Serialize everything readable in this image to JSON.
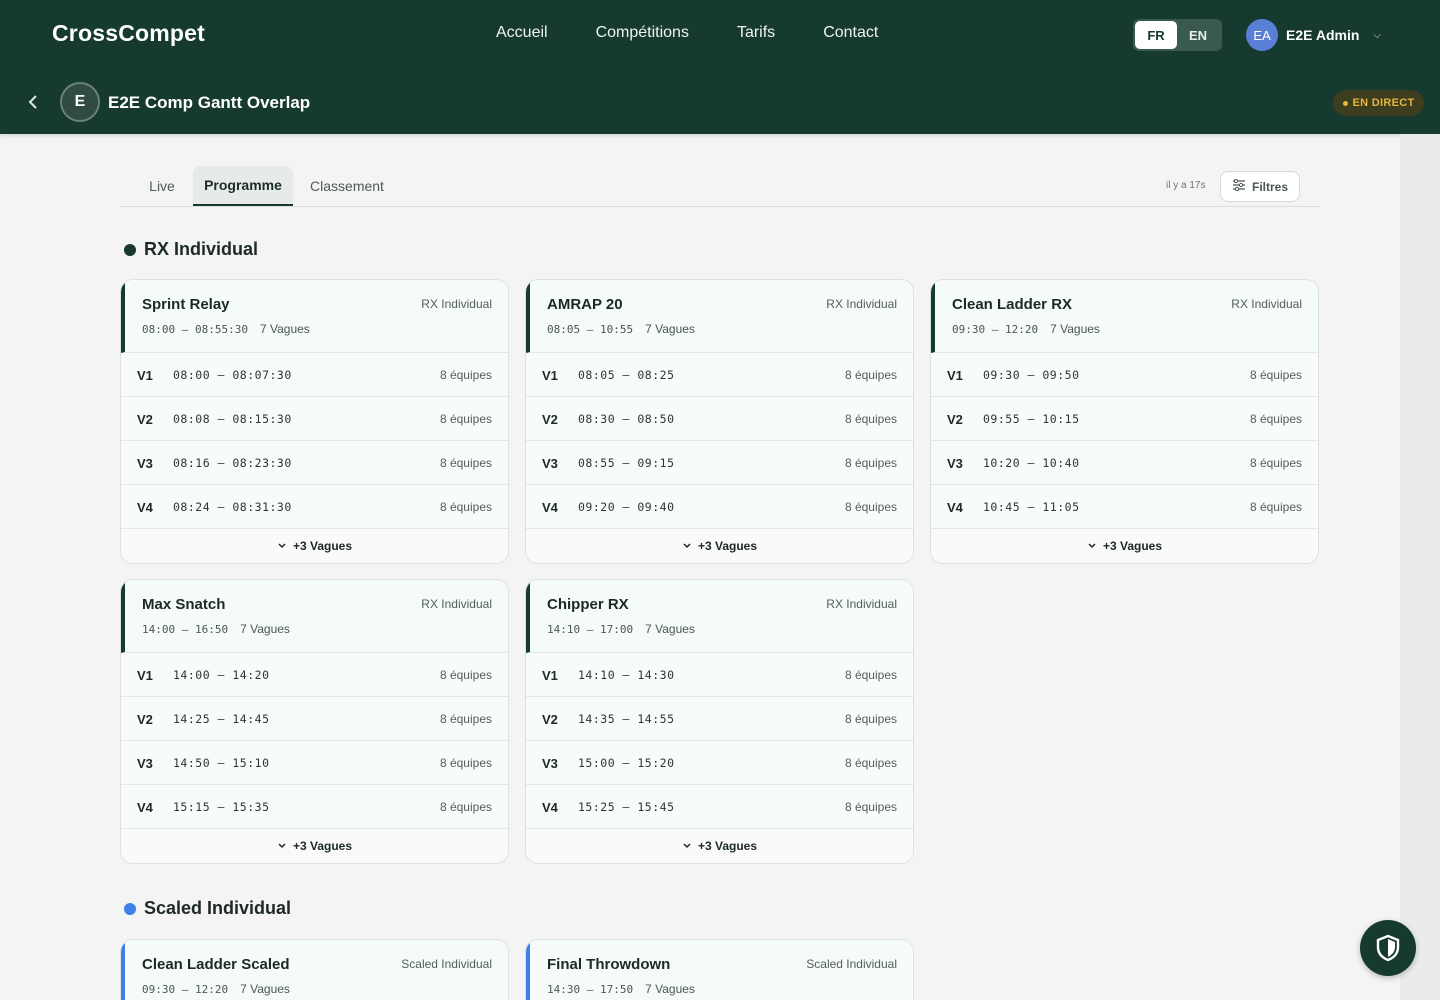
{
  "header": {
    "logo": "CrossCompet",
    "nav": [
      "Accueil",
      "Compétitions",
      "Tarifs",
      "Contact"
    ],
    "lang": {
      "fr": "FR",
      "en": "EN",
      "active": "FR"
    },
    "user": {
      "initials": "EA",
      "name": "E2E Admin"
    }
  },
  "competition": {
    "initial": "E",
    "title": "E2E Comp Gantt Overlap",
    "status": "EN DIRECT"
  },
  "tabs": [
    "Live",
    "Programme",
    "Classement"
  ],
  "active_tab": "Programme",
  "updated": "il y a 17s",
  "filters_label": "Filtres",
  "colors": {
    "primary": "#173a30",
    "rx_dot": "#173a30",
    "scaled_dot": "#3f7fe8",
    "live": "#e7b537"
  },
  "sections": [
    {
      "title": "RX Individual",
      "events": [
        {
          "name": "Sprint Relay",
          "category": "RX Individual",
          "time": "08:00 — 08:55:30",
          "waves": "7 Vagues",
          "rows": [
            [
              "V1",
              "08:00 — 08:07:30",
              "8 équipes"
            ],
            [
              "V2",
              "08:08 — 08:15:30",
              "8 équipes"
            ],
            [
              "V3",
              "08:16 — 08:23:30",
              "8 équipes"
            ],
            [
              "V4",
              "08:24 — 08:31:30",
              "8 équipes"
            ]
          ],
          "more": "+3 Vagues"
        },
        {
          "name": "AMRAP 20",
          "category": "RX Individual",
          "time": "08:05 — 10:55",
          "waves": "7 Vagues",
          "rows": [
            [
              "V1",
              "08:05 — 08:25",
              "8 équipes"
            ],
            [
              "V2",
              "08:30 — 08:50",
              "8 équipes"
            ],
            [
              "V3",
              "08:55 — 09:15",
              "8 équipes"
            ],
            [
              "V4",
              "09:20 — 09:40",
              "8 équipes"
            ]
          ],
          "more": "+3 Vagues"
        },
        {
          "name": "Clean Ladder RX",
          "category": "RX Individual",
          "time": "09:30 — 12:20",
          "waves": "7 Vagues",
          "rows": [
            [
              "V1",
              "09:30 — 09:50",
              "8 équipes"
            ],
            [
              "V2",
              "09:55 — 10:15",
              "8 équipes"
            ],
            [
              "V3",
              "10:20 — 10:40",
              "8 équipes"
            ],
            [
              "V4",
              "10:45 — 11:05",
              "8 équipes"
            ]
          ],
          "more": "+3 Vagues"
        },
        {
          "name": "Max Snatch",
          "category": "RX Individual",
          "time": "14:00 — 16:50",
          "waves": "7 Vagues",
          "rows": [
            [
              "V1",
              "14:00 — 14:20",
              "8 équipes"
            ],
            [
              "V2",
              "14:25 — 14:45",
              "8 équipes"
            ],
            [
              "V3",
              "14:50 — 15:10",
              "8 équipes"
            ],
            [
              "V4",
              "15:15 — 15:35",
              "8 équipes"
            ]
          ],
          "more": "+3 Vagues"
        },
        {
          "name": "Chipper RX",
          "category": "RX Individual",
          "time": "14:10 — 17:00",
          "waves": "7 Vagues",
          "rows": [
            [
              "V1",
              "14:10 — 14:30",
              "8 équipes"
            ],
            [
              "V2",
              "14:35 — 14:55",
              "8 équipes"
            ],
            [
              "V3",
              "15:00 — 15:20",
              "8 équipes"
            ],
            [
              "V4",
              "15:25 — 15:45",
              "8 équipes"
            ]
          ],
          "more": "+3 Vagues"
        }
      ]
    },
    {
      "title": "Scaled Individual",
      "events": [
        {
          "name": "Clean Ladder Scaled",
          "category": "Scaled Individual",
          "time": "09:30 — 12:20",
          "waves": "7 Vagues",
          "rows": [],
          "more": ""
        },
        {
          "name": "Final Throwdown",
          "category": "Scaled Individual",
          "time": "14:30 — 17:50",
          "waves": "7 Vagues",
          "rows": [],
          "more": ""
        }
      ]
    }
  ]
}
